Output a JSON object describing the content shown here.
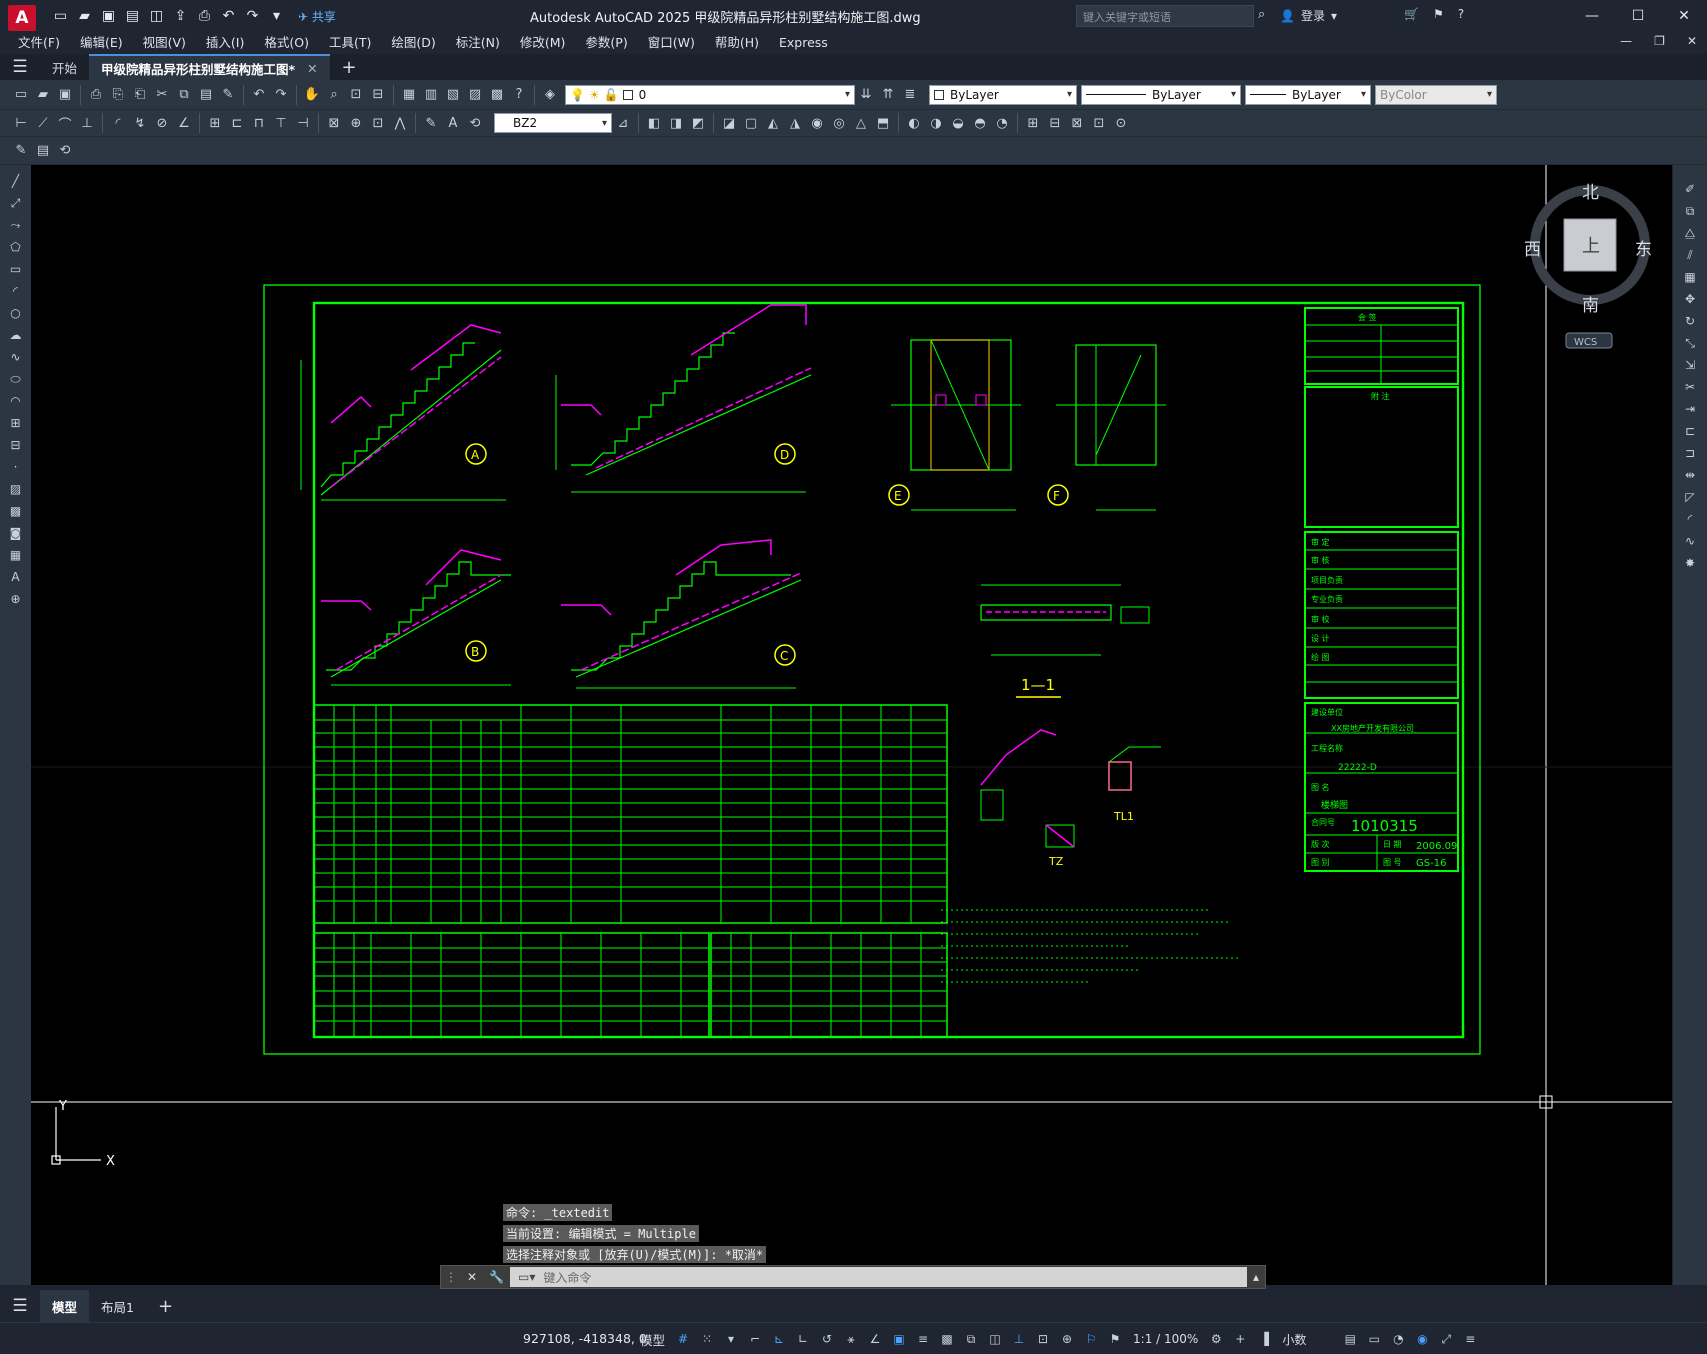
{
  "app": {
    "logo_letter": "A",
    "window_title": "Autodesk AutoCAD 2025    甲级院精品异形柱别墅结构施工图.dwg",
    "share_label": "共享",
    "search_placeholder": "键入关键字或短语",
    "login_label": "登录"
  },
  "menu": [
    "文件(F)",
    "编辑(E)",
    "视图(V)",
    "插入(I)",
    "格式(O)",
    "工具(T)",
    "绘图(D)",
    "标注(N)",
    "修改(M)",
    "参数(P)",
    "窗口(W)",
    "帮助(H)",
    "Express"
  ],
  "tabs": {
    "start": "开始",
    "drawing": "甲级院精品异形柱别墅结构施工图*"
  },
  "toolbar": {
    "layer_value": "0",
    "color_value": "ByLayer",
    "linetype_value": "ByLayer",
    "lineweight_value": "ByLayer",
    "plotstyle_value": "ByColor",
    "dimstyle_value": "BZ2"
  },
  "viewcube": {
    "north": "北",
    "south": "南",
    "east": "东",
    "west": "西",
    "top_face": "上",
    "wcs": "WCS"
  },
  "drawing": {
    "labels": [
      "A",
      "D",
      "E",
      "F",
      "B",
      "C"
    ],
    "section_label": "1—1",
    "tl1_label": "TL1",
    "tz_label": "TZ",
    "contract_no": "1010315",
    "date": "2006.09",
    "sheet_no": "GS-16",
    "sheet_name": "楼梯图",
    "client": "XX房地产开发有限公司",
    "project": "22222-D"
  },
  "command": {
    "history": [
      "命令: _textedit",
      "当前设置: 编辑模式 = Multiple",
      "选择注释对象或 [放弃(U)/模式(M)]: *取消*"
    ],
    "input_placeholder": "键入命令"
  },
  "layout_tabs": [
    "模型",
    "布局1"
  ],
  "status": {
    "coordinates": "927108, -418348, 0",
    "model_label": "模型",
    "scale": "1:1 / 100%",
    "units": "小数"
  },
  "colors": {
    "frame_green": "#00ff00",
    "magenta": "#ff00ff",
    "yellow": "#ffff00",
    "accent_blue": "#4aa3ff",
    "logo_red": "#c8102e"
  }
}
